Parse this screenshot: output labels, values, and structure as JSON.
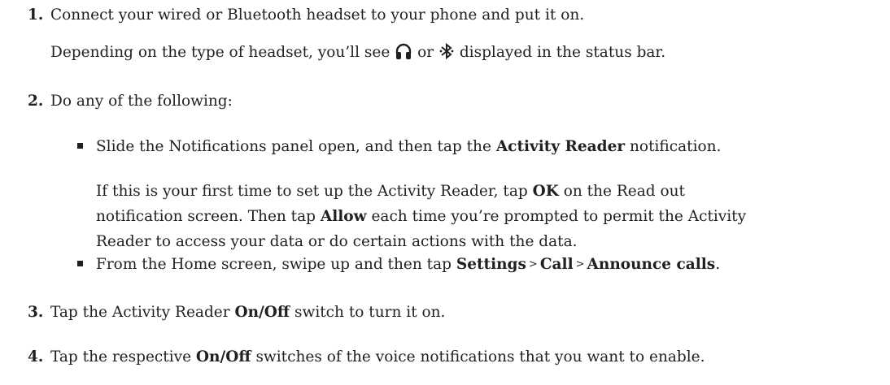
{
  "steps": [
    {
      "number": "1.",
      "text": "Connect your wired or Bluetooth headset to your phone and put it on.",
      "note": {
        "before": "Depending on the type of headset, you’ll see",
        "or": "or",
        "after": "displayed in the status bar."
      },
      "icons": [
        "headset-icon",
        "bluetooth-icon"
      ]
    },
    {
      "number": "2.",
      "text": "Do any of the following:",
      "bullets": [
        {
          "pre": "Slide the Notifications panel open, and then tap the",
          "bold": "Activity Reader",
          "post": "notification.",
          "para": {
            "l1_pre": "If this is your first time to set up the Activity Reader, tap",
            "l1_bold": "OK",
            "l1_post": "on the Read out",
            "l2_pre": "notification screen. Then tap",
            "l2_bold": "Allow",
            "l2_post": "each time you’re prompted to permit the Activity",
            "l3": "Reader to access your data or do certain actions with the data."
          }
        },
        {
          "pre": "From the Home screen, swipe up and then tap",
          "path": [
            "Settings",
            "Call",
            "Announce calls"
          ],
          "separator": ">",
          "post": "."
        }
      ]
    },
    {
      "number": "3.",
      "pre": "Tap the Activity Reader",
      "bold": "On/Off",
      "post": "switch to turn it on."
    },
    {
      "number": "4.",
      "pre": "Tap the respective",
      "bold": "On/Off",
      "post": "switches of the voice notifications that you want to enable."
    }
  ]
}
